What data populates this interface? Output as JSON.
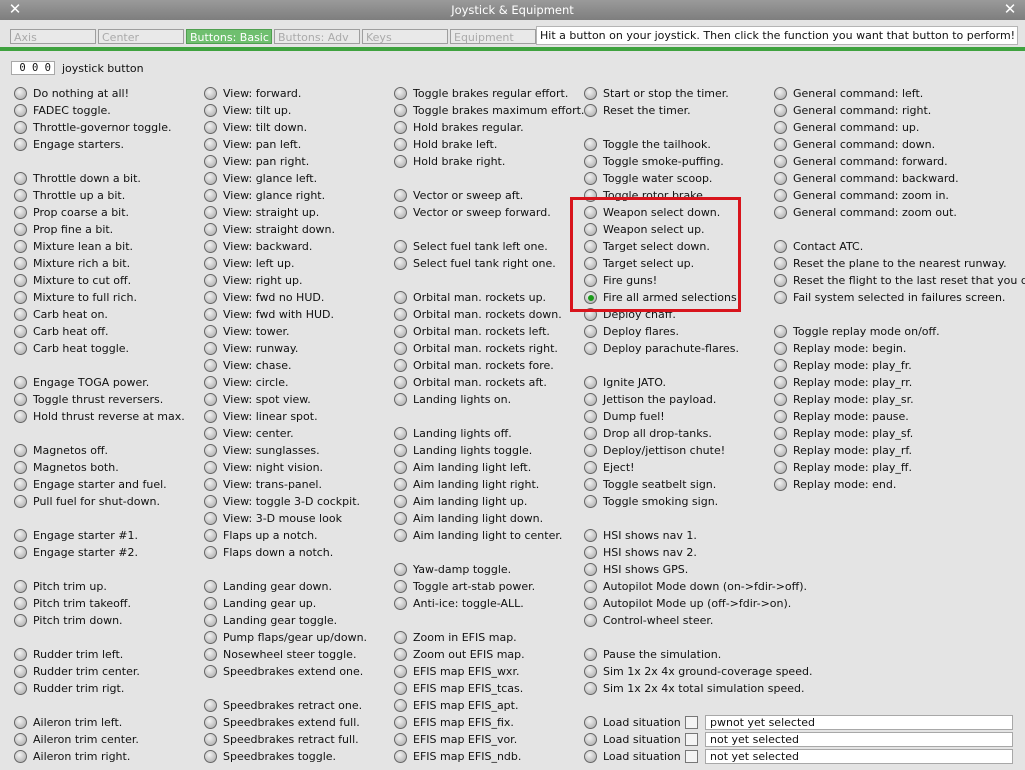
{
  "window": {
    "title": "Joystick & Equipment"
  },
  "tabs": [
    {
      "label": "Axis",
      "active": false
    },
    {
      "label": "Center",
      "active": false
    },
    {
      "label": "Buttons: Basic",
      "active": true
    },
    {
      "label": "Buttons: Adv",
      "active": false
    },
    {
      "label": "Keys",
      "active": false
    },
    {
      "label": "Equipment",
      "active": false
    }
  ],
  "hint": "Hit a button on your joystick. Then click the function you want that button to perform!",
  "button_number": {
    "value": "0 0 0",
    "label": "joystick button"
  },
  "colors": {
    "active_tab": "#6fbf6f",
    "accent_line": "#3fa23f",
    "selected_radio": "#1a9b1a",
    "highlight_box": "#d8141c"
  },
  "columns": [
    [
      {
        "row": 0,
        "label": "Do nothing at all!"
      },
      {
        "row": 1,
        "label": "FADEC toggle."
      },
      {
        "row": 2,
        "label": "Throttle-governor toggle."
      },
      {
        "row": 3,
        "label": "Engage starters."
      },
      {
        "row": 5,
        "label": "Throttle down a bit."
      },
      {
        "row": 6,
        "label": "Throttle up a bit."
      },
      {
        "row": 7,
        "label": "Prop coarse a bit."
      },
      {
        "row": 8,
        "label": "Prop fine a bit."
      },
      {
        "row": 9,
        "label": "Mixture lean a bit."
      },
      {
        "row": 10,
        "label": "Mixture rich a bit."
      },
      {
        "row": 11,
        "label": "Mixture to cut off."
      },
      {
        "row": 12,
        "label": "Mixture to full rich."
      },
      {
        "row": 13,
        "label": "Carb heat on."
      },
      {
        "row": 14,
        "label": "Carb heat off."
      },
      {
        "row": 15,
        "label": "Carb heat toggle."
      },
      {
        "row": 17,
        "label": "Engage TOGA power."
      },
      {
        "row": 18,
        "label": "Toggle thrust reversers."
      },
      {
        "row": 19,
        "label": "Hold thrust reverse at max."
      },
      {
        "row": 21,
        "label": "Magnetos off."
      },
      {
        "row": 22,
        "label": "Magnetos both."
      },
      {
        "row": 23,
        "label": "Engage starter and fuel."
      },
      {
        "row": 24,
        "label": "Pull fuel for shut-down."
      },
      {
        "row": 26,
        "label": "Engage starter #1."
      },
      {
        "row": 27,
        "label": "Engage starter #2."
      },
      {
        "row": 29,
        "label": "Pitch trim up."
      },
      {
        "row": 30,
        "label": "Pitch trim takeoff."
      },
      {
        "row": 31,
        "label": "Pitch trim down."
      },
      {
        "row": 33,
        "label": "Rudder trim left."
      },
      {
        "row": 34,
        "label": "Rudder trim center."
      },
      {
        "row": 35,
        "label": "Rudder trim rigt."
      },
      {
        "row": 37,
        "label": "Aileron trim left."
      },
      {
        "row": 38,
        "label": "Aileron trim center."
      },
      {
        "row": 39,
        "label": "Aileron trim right."
      }
    ],
    [
      {
        "row": 0,
        "label": "View: forward."
      },
      {
        "row": 1,
        "label": "View: tilt up."
      },
      {
        "row": 2,
        "label": "View: tilt down."
      },
      {
        "row": 3,
        "label": "View: pan left."
      },
      {
        "row": 4,
        "label": "View: pan right."
      },
      {
        "row": 5,
        "label": "View: glance left."
      },
      {
        "row": 6,
        "label": "View: glance right."
      },
      {
        "row": 7,
        "label": "View: straight up."
      },
      {
        "row": 8,
        "label": "View: straight down."
      },
      {
        "row": 9,
        "label": "View: backward."
      },
      {
        "row": 10,
        "label": "View: left up."
      },
      {
        "row": 11,
        "label": "View: right up."
      },
      {
        "row": 12,
        "label": "View: fwd no HUD."
      },
      {
        "row": 13,
        "label": "View: fwd with HUD."
      },
      {
        "row": 14,
        "label": "View: tower."
      },
      {
        "row": 15,
        "label": "View: runway."
      },
      {
        "row": 16,
        "label": "View: chase."
      },
      {
        "row": 17,
        "label": "View: circle."
      },
      {
        "row": 18,
        "label": "View: spot view."
      },
      {
        "row": 19,
        "label": "View: linear spot."
      },
      {
        "row": 20,
        "label": "View: center."
      },
      {
        "row": 21,
        "label": "View: sunglasses."
      },
      {
        "row": 22,
        "label": "View: night vision."
      },
      {
        "row": 23,
        "label": "View: trans-panel."
      },
      {
        "row": 24,
        "label": "View: toggle 3-D cockpit."
      },
      {
        "row": 25,
        "label": "View: 3-D mouse look"
      },
      {
        "row": 26,
        "label": "Flaps up a notch."
      },
      {
        "row": 27,
        "label": "Flaps down a notch."
      },
      {
        "row": 29,
        "label": "Landing gear down."
      },
      {
        "row": 30,
        "label": "Landing gear up."
      },
      {
        "row": 31,
        "label": "Landing gear toggle."
      },
      {
        "row": 32,
        "label": "Pump flaps/gear up/down."
      },
      {
        "row": 33,
        "label": "Nosewheel steer toggle."
      },
      {
        "row": 34,
        "label": "Speedbrakes extend one."
      },
      {
        "row": 36,
        "label": "Speedbrakes retract one."
      },
      {
        "row": 37,
        "label": "Speedbrakes extend full."
      },
      {
        "row": 38,
        "label": "Speedbrakes retract full."
      },
      {
        "row": 39,
        "label": "Speedbrakes toggle."
      }
    ],
    [
      {
        "row": 0,
        "label": "Toggle brakes regular effort."
      },
      {
        "row": 1,
        "label": "Toggle brakes maximum effort."
      },
      {
        "row": 2,
        "label": "Hold brakes regular."
      },
      {
        "row": 3,
        "label": "Hold brake left."
      },
      {
        "row": 4,
        "label": "Hold brake right."
      },
      {
        "row": 6,
        "label": "Vector or sweep aft."
      },
      {
        "row": 7,
        "label": "Vector or sweep forward."
      },
      {
        "row": 9,
        "label": "Select fuel tank left one."
      },
      {
        "row": 10,
        "label": "Select fuel tank right one."
      },
      {
        "row": 12,
        "label": "Orbital man. rockets up."
      },
      {
        "row": 13,
        "label": "Orbital man. rockets down."
      },
      {
        "row": 14,
        "label": "Orbital man. rockets left."
      },
      {
        "row": 15,
        "label": "Orbital man. rockets right."
      },
      {
        "row": 16,
        "label": "Orbital man. rockets fore."
      },
      {
        "row": 17,
        "label": "Orbital man. rockets aft."
      },
      {
        "row": 18,
        "label": "Landing lights on."
      },
      {
        "row": 20,
        "label": "Landing lights off."
      },
      {
        "row": 21,
        "label": "Landing lights toggle."
      },
      {
        "row": 22,
        "label": "Aim landing light left."
      },
      {
        "row": 23,
        "label": "Aim landing light right."
      },
      {
        "row": 24,
        "label": "Aim landing light up."
      },
      {
        "row": 25,
        "label": "Aim landing light down."
      },
      {
        "row": 26,
        "label": "Aim landing light to center."
      },
      {
        "row": 28,
        "label": "Yaw-damp toggle."
      },
      {
        "row": 29,
        "label": "Toggle art-stab power."
      },
      {
        "row": 30,
        "label": "Anti-ice: toggle-ALL."
      },
      {
        "row": 32,
        "label": "Zoom in EFIS map."
      },
      {
        "row": 33,
        "label": "Zoom out EFIS map."
      },
      {
        "row": 34,
        "label": "EFIS map EFIS_wxr."
      },
      {
        "row": 35,
        "label": "EFIS map EFIS_tcas."
      },
      {
        "row": 36,
        "label": "EFIS map EFIS_apt."
      },
      {
        "row": 37,
        "label": "EFIS map EFIS_fix."
      },
      {
        "row": 38,
        "label": "EFIS map EFIS_vor."
      },
      {
        "row": 39,
        "label": "EFIS map EFIS_ndb."
      }
    ],
    [
      {
        "row": 0,
        "label": "Start or stop the timer."
      },
      {
        "row": 1,
        "label": "Reset the timer."
      },
      {
        "row": 3,
        "label": "Toggle the tailhook."
      },
      {
        "row": 4,
        "label": "Toggle smoke-puffing."
      },
      {
        "row": 5,
        "label": "Toggle water scoop."
      },
      {
        "row": 6,
        "label": "Toggle rotor brake."
      },
      {
        "row": 7,
        "label": "Weapon select down."
      },
      {
        "row": 8,
        "label": "Weapon select up."
      },
      {
        "row": 9,
        "label": "Target select down."
      },
      {
        "row": 10,
        "label": "Target select up."
      },
      {
        "row": 11,
        "label": "Fire guns!"
      },
      {
        "row": 12,
        "label": "Fire all armed selections!",
        "selected": true
      },
      {
        "row": 13,
        "label": "Deploy chaff."
      },
      {
        "row": 14,
        "label": "Deploy flares."
      },
      {
        "row": 15,
        "label": "Deploy parachute-flares."
      },
      {
        "row": 17,
        "label": "Ignite JATO."
      },
      {
        "row": 18,
        "label": "Jettison the payload."
      },
      {
        "row": 19,
        "label": "Dump fuel!"
      },
      {
        "row": 20,
        "label": "Drop all drop-tanks."
      },
      {
        "row": 21,
        "label": "Deploy/jettison chute!"
      },
      {
        "row": 22,
        "label": "Eject!"
      },
      {
        "row": 23,
        "label": "Toggle seatbelt sign."
      },
      {
        "row": 24,
        "label": "Toggle smoking sign."
      },
      {
        "row": 26,
        "label": "HSI shows nav 1."
      },
      {
        "row": 27,
        "label": "HSI shows nav 2."
      },
      {
        "row": 28,
        "label": "HSI shows GPS."
      },
      {
        "row": 29,
        "label": "Autopilot Mode down (on->fdir->off)."
      },
      {
        "row": 30,
        "label": "Autopilot Mode up (off->fdir->on)."
      },
      {
        "row": 31,
        "label": "Control-wheel steer."
      },
      {
        "row": 33,
        "label": "Pause the simulation."
      },
      {
        "row": 34,
        "label": "Sim 1x 2x 4x ground-coverage speed."
      },
      {
        "row": 35,
        "label": "Sim 1x 2x 4x total simulation speed."
      },
      {
        "row": 37,
        "label": "Load situation"
      },
      {
        "row": 38,
        "label": "Load situation"
      },
      {
        "row": 39,
        "label": "Load situation"
      }
    ],
    [
      {
        "row": 0,
        "label": "General command: left."
      },
      {
        "row": 1,
        "label": "General command: right."
      },
      {
        "row": 2,
        "label": "General command: up."
      },
      {
        "row": 3,
        "label": "General command: down."
      },
      {
        "row": 4,
        "label": "General command: forward."
      },
      {
        "row": 5,
        "label": "General command: backward."
      },
      {
        "row": 6,
        "label": "General command: zoom in."
      },
      {
        "row": 7,
        "label": "General command: zoom out."
      },
      {
        "row": 9,
        "label": "Contact ATC."
      },
      {
        "row": 10,
        "label": "Reset the plane to the nearest runway."
      },
      {
        "row": 11,
        "label": "Reset the flight to the last reset that you did."
      },
      {
        "row": 12,
        "label": "Fail system selected in failures screen."
      },
      {
        "row": 14,
        "label": "Toggle replay mode on/off."
      },
      {
        "row": 15,
        "label": "Replay mode: begin."
      },
      {
        "row": 16,
        "label": "Replay mode: play_fr."
      },
      {
        "row": 17,
        "label": "Replay mode: play_rr."
      },
      {
        "row": 18,
        "label": "Replay mode: play_sr."
      },
      {
        "row": 19,
        "label": "Replay mode: pause."
      },
      {
        "row": 20,
        "label": "Replay mode: play_sf."
      },
      {
        "row": 21,
        "label": "Replay mode: play_rf."
      },
      {
        "row": 22,
        "label": "Replay mode: play_ff."
      },
      {
        "row": 23,
        "label": "Replay mode: end."
      }
    ]
  ],
  "situations": [
    {
      "row": 37,
      "value": "pwnot yet selected"
    },
    {
      "row": 38,
      "value": "not yet selected"
    },
    {
      "row": 39,
      "value": "not yet selected"
    }
  ]
}
